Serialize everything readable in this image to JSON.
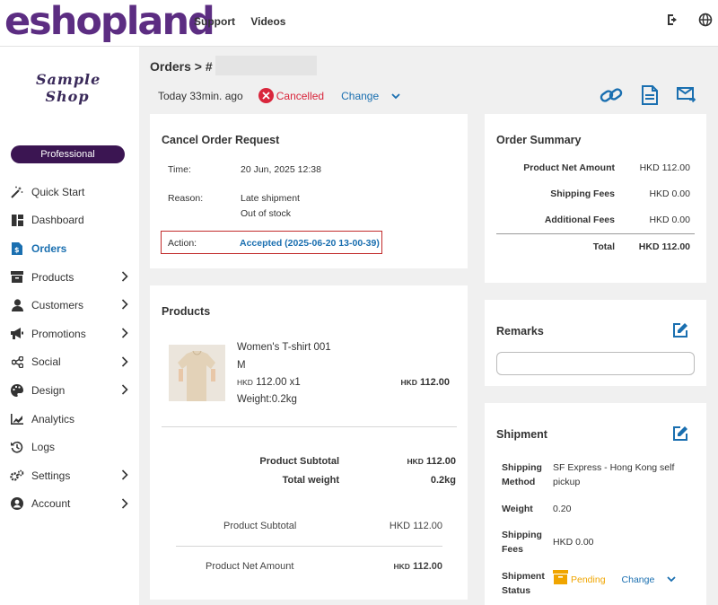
{
  "brand": {
    "logo_text": "eshopland",
    "accent": "#5c2d82"
  },
  "topnav": {
    "items": [
      "Support",
      "Videos"
    ]
  },
  "topicons": [
    "logout-icon",
    "globe-icon"
  ],
  "shop": {
    "name_line1": "Sample",
    "name_line2": "Shop",
    "plan": "Professional"
  },
  "sidebar": {
    "items": [
      {
        "label": "Quick Start",
        "icon": "magic-wand-icon",
        "chevron": false
      },
      {
        "label": "Dashboard",
        "icon": "dashboard-icon",
        "chevron": false
      },
      {
        "label": "Orders",
        "icon": "order-icon",
        "chevron": false,
        "active": true
      },
      {
        "label": "Products",
        "icon": "box-icon",
        "chevron": true
      },
      {
        "label": "Customers",
        "icon": "user-icon",
        "chevron": true
      },
      {
        "label": "Promotions",
        "icon": "megaphone-icon",
        "chevron": true
      },
      {
        "label": "Social",
        "icon": "share-icon",
        "chevron": true
      },
      {
        "label": "Design",
        "icon": "palette-icon",
        "chevron": true
      },
      {
        "label": "Analytics",
        "icon": "chart-icon",
        "chevron": false
      },
      {
        "label": "Logs",
        "icon": "history-icon",
        "chevron": false
      },
      {
        "label": "Settings",
        "icon": "gears-icon",
        "chevron": true
      },
      {
        "label": "Account",
        "icon": "account-icon",
        "chevron": true
      }
    ]
  },
  "header": {
    "breadcrumb": "Orders > #",
    "time": "Today 33min. ago",
    "status": "Cancelled",
    "change_label": "Change"
  },
  "cancel_request": {
    "title": "Cancel Order Request",
    "time_label": "Time:",
    "time_value": "20 Jun, 2025 12:38",
    "reason_label": "Reason:",
    "reason_line1": "Late shipment",
    "reason_line2": "Out of stock",
    "action_label": "Action:",
    "action_value": "Accepted (2025-06-20 13-00-39)"
  },
  "products": {
    "title": "Products",
    "item": {
      "name": "Women's T-shirt 001",
      "variant": "M",
      "currency": "HKD",
      "unit_price_qty": "112.00 x1",
      "weight": "Weight:0.2kg",
      "total_currency": "HKD",
      "total": "112.00"
    },
    "subtotal_label": "Product Subtotal",
    "subtotal_currency": "HKD",
    "subtotal_value": "112.00",
    "weight_label": "Total weight",
    "weight_value": "0.2kg",
    "subtotal2_label": "Product Subtotal",
    "subtotal2_value": "HKD 112.00",
    "net_label": "Product Net Amount",
    "net_currency": "HKD",
    "net_value": "112.00"
  },
  "order_summary": {
    "title": "Order Summary",
    "rows": [
      {
        "label": "Product Net Amount",
        "value": "HKD 112.00"
      },
      {
        "label": "Shipping Fees",
        "value": "HKD 0.00"
      },
      {
        "label": "Additional Fees",
        "value": "HKD 0.00"
      }
    ],
    "total_label": "Total",
    "total_value": "HKD 112.00"
  },
  "remarks": {
    "title": "Remarks"
  },
  "shipment": {
    "title": "Shipment",
    "method_label_1": "Shipping",
    "method_label_2": "Method",
    "method_value": "SF Express - Hong Kong self pickup",
    "weight_label": "Weight",
    "weight_value": "0.20",
    "fees_label_1": "Shipping",
    "fees_label_2": "Fees",
    "fees_value": "HKD 0.00",
    "status_label_1": "Shipment",
    "status_label_2": "Status",
    "status_value": "Pending",
    "change_label": "Change"
  }
}
